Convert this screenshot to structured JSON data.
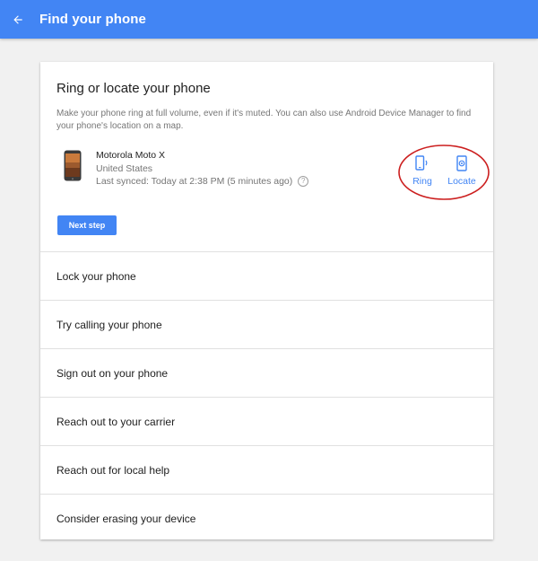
{
  "header": {
    "title": "Find your phone",
    "back_icon": "arrow-back-icon",
    "color": "#4285f4"
  },
  "main_section": {
    "title": "Ring or locate your phone",
    "description": "Make your phone ring at full volume, even if it's muted. You can also use Android Device Manager to find your phone's location on a map.",
    "device": {
      "name": "Motorola Moto X",
      "country": "United States",
      "last_synced": "Last synced: Today at 2:38 PM (5 minutes ago)",
      "help_icon": "?"
    },
    "actions": {
      "ring_label": "Ring",
      "locate_label": "Locate"
    },
    "next_step_label": "Next step",
    "highlight_color": "#cc1f1f"
  },
  "steps": [
    "Lock your phone",
    "Try calling your phone",
    "Sign out on your phone",
    "Reach out to your carrier",
    "Reach out for local help",
    "Consider erasing your device"
  ]
}
